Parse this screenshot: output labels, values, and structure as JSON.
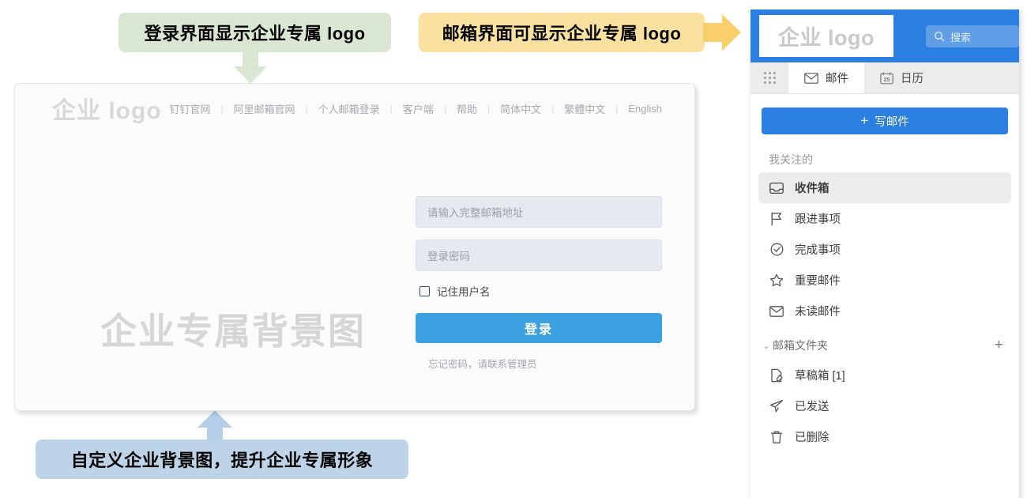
{
  "callouts": {
    "login_logo": "登录界面显示企业专属 logo",
    "mail_logo": "邮箱界面可显示企业专属 logo",
    "background": "自定义企业背景图，提升企业专属形象"
  },
  "login": {
    "logo_text": "企业 logo",
    "watermark": "企业专属背景图",
    "nav": [
      "钉钉官网",
      "阿里邮箱官网",
      "个人邮箱登录",
      "客户端",
      "帮助",
      "简体中文",
      "繁體中文",
      "English"
    ],
    "account_placeholder": "请输入完整邮箱地址",
    "password_placeholder": "登录密码",
    "remember_label": "记住用户名",
    "submit_label": "登录",
    "forgot_text": "忘记密码，请联系管理员"
  },
  "mail": {
    "logo_text": "企业 logo",
    "search_placeholder": "搜索",
    "tabs": [
      {
        "label": "邮件",
        "icon": "envelope-icon",
        "active": true
      },
      {
        "label": "日历",
        "icon": "calendar-icon",
        "active": false
      }
    ],
    "calendar_day": "25",
    "compose_label": "写邮件",
    "compose_plus": "+",
    "section_label": "我关注的",
    "nav_items": [
      {
        "label": "收件箱",
        "icon": "inbox-icon",
        "selected": true
      },
      {
        "label": "跟进事项",
        "icon": "flag-icon",
        "selected": false
      },
      {
        "label": "完成事项",
        "icon": "check-circle-icon",
        "selected": false
      },
      {
        "label": "重要邮件",
        "icon": "star-icon",
        "selected": false
      },
      {
        "label": "未读邮件",
        "icon": "envelope-icon",
        "selected": false
      }
    ],
    "folder_section": {
      "label": "邮箱文件夹",
      "chevron": "⌄",
      "add": "+"
    },
    "folders": [
      {
        "label": "草稿箱 [1]",
        "icon": "draft-icon"
      },
      {
        "label": "已发送",
        "icon": "send-icon"
      },
      {
        "label": "已删除",
        "icon": "trash-icon"
      }
    ]
  },
  "colors": {
    "green_callout": "#d9e7d2",
    "yellow_callout": "#fae1a0",
    "blue_callout": "#bdd3e8",
    "mail_brand_blue": "#2a7fe0",
    "login_button_blue": "#3ba0e0"
  }
}
